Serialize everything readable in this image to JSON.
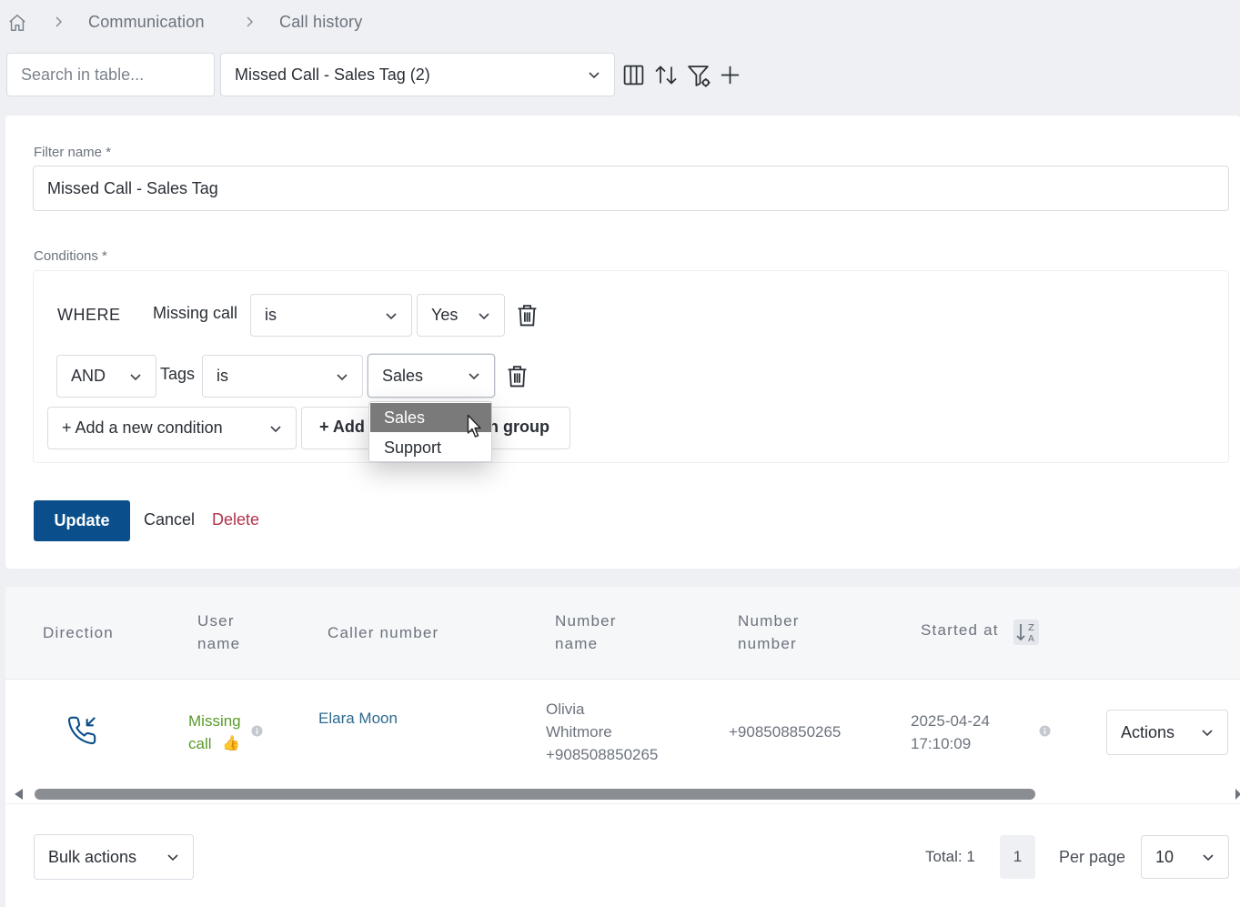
{
  "breadcrumb": {
    "home_icon": "home-icon",
    "items": [
      "Communication",
      "Call history"
    ]
  },
  "toolbar": {
    "search_placeholder": "Search in table...",
    "filter_select_value": "Missed Call - Sales Tag (2)",
    "icons": [
      "columns-icon",
      "sort-icon",
      "filter-settings-icon",
      "plus-icon"
    ]
  },
  "filter_form": {
    "filter_name_label": "Filter name *",
    "filter_name_value": "Missed Call - Sales Tag",
    "conditions_label": "Conditions *",
    "conditions": [
      {
        "connector": "WHERE",
        "field": "Missing call",
        "operator": "is",
        "value": "Yes"
      },
      {
        "connector": "AND",
        "field": "Tags",
        "operator": "is",
        "value": "Sales"
      }
    ],
    "add_condition_label": "+ Add a new condition",
    "add_group_label_left": "+ Add",
    "add_group_label_right": "n group",
    "dropdown_options": [
      "Sales",
      "Support"
    ],
    "dropdown_highlighted": "Sales",
    "update_label": "Update",
    "cancel_label": "Cancel",
    "delete_label": "Delete"
  },
  "table": {
    "headers": {
      "direction": "Direction",
      "user_name_1": "User",
      "user_name_2": "name",
      "caller_number": "Caller number",
      "number_name_1": "Number",
      "number_name_2": "name",
      "number_number_1": "Number",
      "number_number_2": "number",
      "started_at": "Started at"
    },
    "rows": [
      {
        "direction_icon": "incoming-call-icon",
        "user_name_1": "Missing",
        "user_name_2": "call",
        "user_emoji": "👍",
        "caller_number": "Elara Moon",
        "number_name_1": "Olivia",
        "number_name_2": "Whitmore",
        "number_name_3": "+908508850265",
        "number_number": "+908508850265",
        "started_at_1": "2025-04-24",
        "started_at_2": "17:10:09",
        "actions_label": "Actions"
      }
    ]
  },
  "footer": {
    "bulk_actions_label": "Bulk actions",
    "total_label": "Total: 1",
    "current_page": "1",
    "per_page_label": "Per page",
    "per_page_value": "10"
  },
  "colors": {
    "primary": "#0a4f8c",
    "delete": "#b0344a",
    "missing_call_green": "#5a9a2a",
    "caller_link": "#2d6a8f"
  }
}
